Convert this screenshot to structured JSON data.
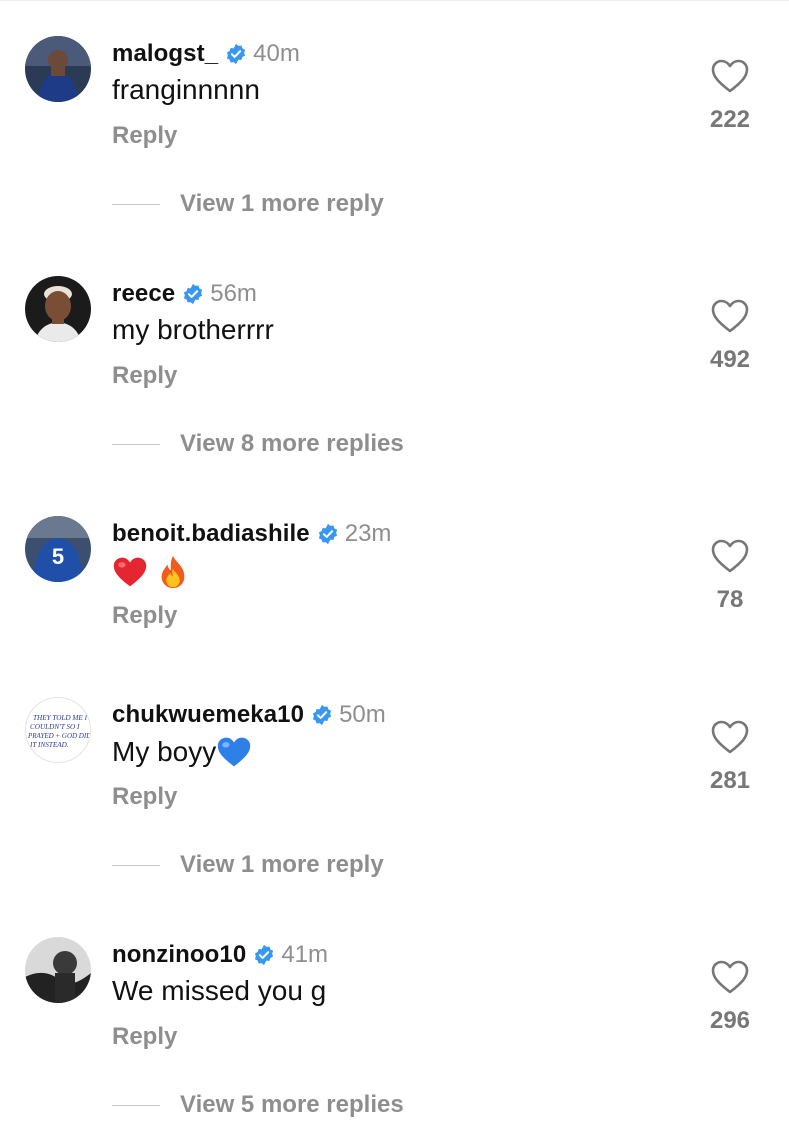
{
  "comments": [
    {
      "username": "malogst_",
      "time": "40m",
      "text": "franginnnnn",
      "reply_label": "Reply",
      "likes": "222",
      "view_more": "View 1 more reply",
      "avatar": "player-photo-avatar"
    },
    {
      "username": "reece",
      "time": "56m",
      "text": "my brotherrrr",
      "reply_label": "Reply",
      "likes": "492",
      "view_more": "View 8 more replies",
      "avatar": "player-portrait-avatar"
    },
    {
      "username": "benoit.badiashile",
      "time": "23m",
      "text": "",
      "emojis": [
        "red-heart",
        "fire"
      ],
      "reply_label": "Reply",
      "likes": "78",
      "avatar": "jersey-number-5-avatar"
    },
    {
      "username": "chukwuemeka10",
      "time": "50m",
      "text": "My boyy",
      "emojis": [
        "blue-heart"
      ],
      "reply_label": "Reply",
      "likes": "281",
      "view_more": "View 1 more reply",
      "avatar": "handwritten-note-avatar",
      "avatar_text": [
        "THEY TOLD ME I",
        "COULDN'T SO I",
        "PRAYED + GOD DID",
        "IT INSTEAD."
      ]
    },
    {
      "username": "nonzinoo10",
      "time": "41m",
      "text": "We missed you g",
      "reply_label": "Reply",
      "likes": "296",
      "view_more": "View 5 more replies",
      "avatar": "monochrome-photo-avatar"
    }
  ],
  "colors": {
    "verified_badge": "#3897f0",
    "secondary_text": "#8e8e8e",
    "primary_text": "#111111"
  }
}
